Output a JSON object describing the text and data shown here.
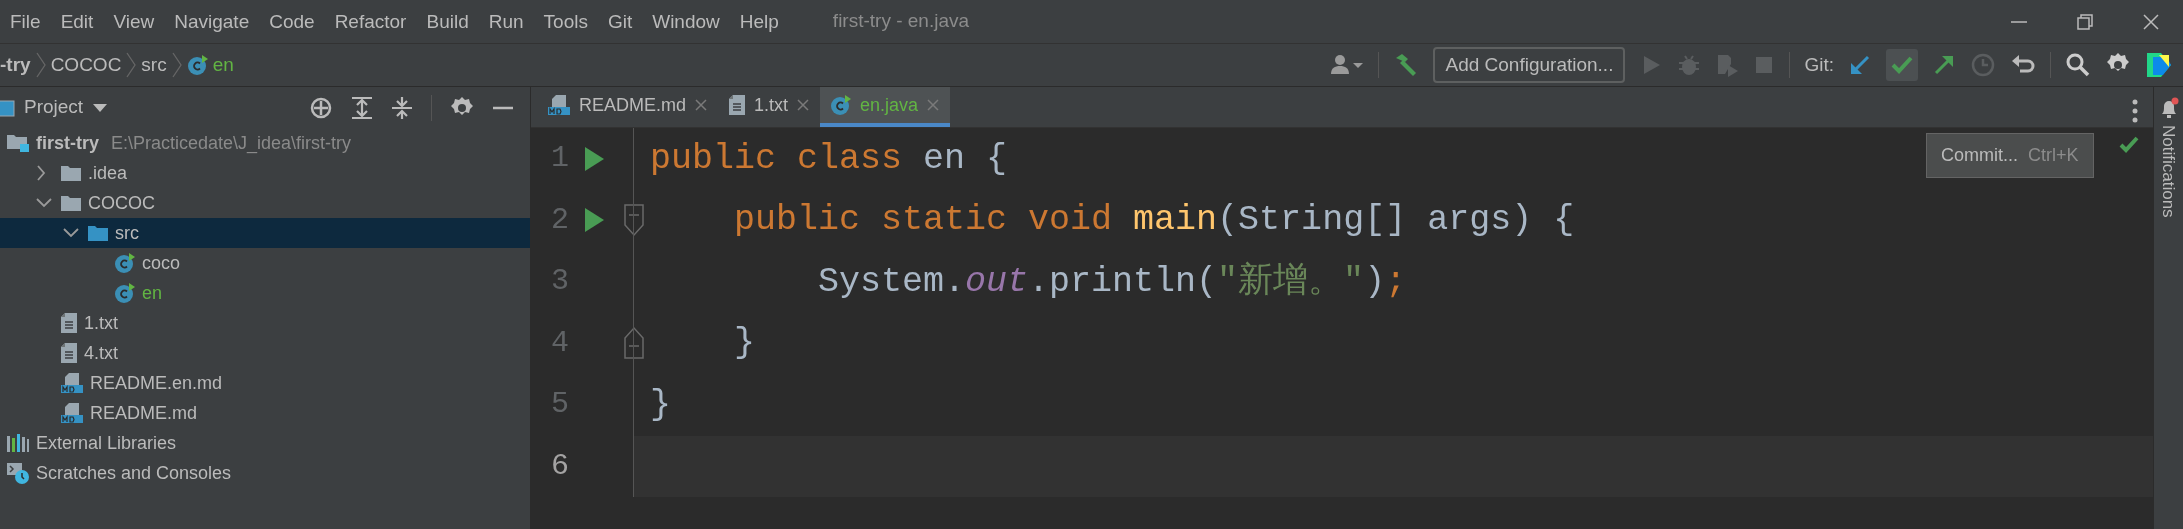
{
  "window": {
    "title": "first-try - en.java"
  },
  "menu": [
    "File",
    "Edit",
    "View",
    "Navigate",
    "Code",
    "Refactor",
    "Build",
    "Run",
    "Tools",
    "Git",
    "Window",
    "Help"
  ],
  "breadcrumbs": [
    {
      "label": "-try",
      "kind": "project",
      "added": false
    },
    {
      "label": "COCOC",
      "kind": "folder",
      "added": false
    },
    {
      "label": "src",
      "kind": "folder",
      "added": false
    },
    {
      "label": "en",
      "kind": "class",
      "added": true
    }
  ],
  "toolbar": {
    "run_config": "Add Configuration...",
    "git_label": "Git:",
    "tooltip": {
      "label": "Commit...",
      "shortcut": "Ctrl+K"
    }
  },
  "project_panel": {
    "title": "Project",
    "tree": [
      {
        "label": "first-try",
        "path": "E:\\Practicedate\\J_idea\\first-try",
        "kind": "project",
        "selected": false,
        "added": false,
        "children": [
          {
            "label": ".idea",
            "kind": "folder",
            "expanded": false,
            "selected": false,
            "added": false
          },
          {
            "label": "COCOC",
            "kind": "folder",
            "expanded": true,
            "selected": false,
            "added": false,
            "children": [
              {
                "label": "src",
                "kind": "source",
                "expanded": true,
                "selected": true,
                "added": false,
                "children": [
                  {
                    "label": "coco",
                    "kind": "class",
                    "selected": false,
                    "added": false
                  },
                  {
                    "label": "en",
                    "kind": "class",
                    "selected": false,
                    "added": true
                  }
                ]
              }
            ]
          },
          {
            "label": "1.txt",
            "kind": "text",
            "selected": false,
            "added": false
          },
          {
            "label": "4.txt",
            "kind": "text",
            "selected": false,
            "added": false
          },
          {
            "label": "README.en.md",
            "kind": "markdown",
            "selected": false,
            "added": false
          },
          {
            "label": "README.md",
            "kind": "markdown",
            "selected": false,
            "added": false
          }
        ]
      },
      {
        "label": "External Libraries",
        "kind": "libraries",
        "selected": false,
        "added": false
      },
      {
        "label": "Scratches and Consoles",
        "kind": "scratches",
        "selected": false,
        "added": false
      }
    ]
  },
  "tabs": [
    {
      "label": "README.md",
      "kind": "markdown",
      "selected": false,
      "added": false
    },
    {
      "label": "1.txt",
      "kind": "text",
      "selected": false,
      "added": false
    },
    {
      "label": "en.java",
      "kind": "class",
      "selected": true,
      "added": true
    }
  ],
  "editor": {
    "lines": [
      {
        "number": "1",
        "run": true,
        "fold_open": false,
        "fold_close": false,
        "current": false,
        "tokens": [
          {
            "kind": "keyword",
            "text": "public class"
          },
          {
            "kind": "plain",
            "text": " en {"
          }
        ]
      },
      {
        "number": "2",
        "run": true,
        "fold_open": true,
        "fold_close": false,
        "current": false,
        "tokens": [
          {
            "kind": "keyword",
            "text": "    public static void "
          },
          {
            "kind": "method",
            "text": "main"
          },
          {
            "kind": "plain",
            "text": "(String[] args) {"
          }
        ]
      },
      {
        "number": "3",
        "run": false,
        "fold_open": false,
        "fold_close": false,
        "current": false,
        "tokens": [
          {
            "kind": "plain",
            "text": "        System."
          },
          {
            "kind": "field",
            "text": "out"
          },
          {
            "kind": "plain",
            "text": ".println("
          },
          {
            "kind": "string",
            "text": "\"新增。\""
          },
          {
            "kind": "plain",
            "text": ")"
          },
          {
            "kind": "separator",
            "text": ";"
          }
        ]
      },
      {
        "number": "4",
        "run": false,
        "fold_open": false,
        "fold_close": true,
        "current": false,
        "tokens": [
          {
            "kind": "plain",
            "text": "    }"
          }
        ]
      },
      {
        "number": "5",
        "run": false,
        "fold_open": false,
        "fold_close": false,
        "current": false,
        "tokens": [
          {
            "kind": "plain",
            "text": "}"
          }
        ]
      },
      {
        "number": "6",
        "run": false,
        "fold_open": false,
        "fold_close": false,
        "current": true
      }
    ]
  },
  "side_strip": {
    "label": "Notifications"
  }
}
